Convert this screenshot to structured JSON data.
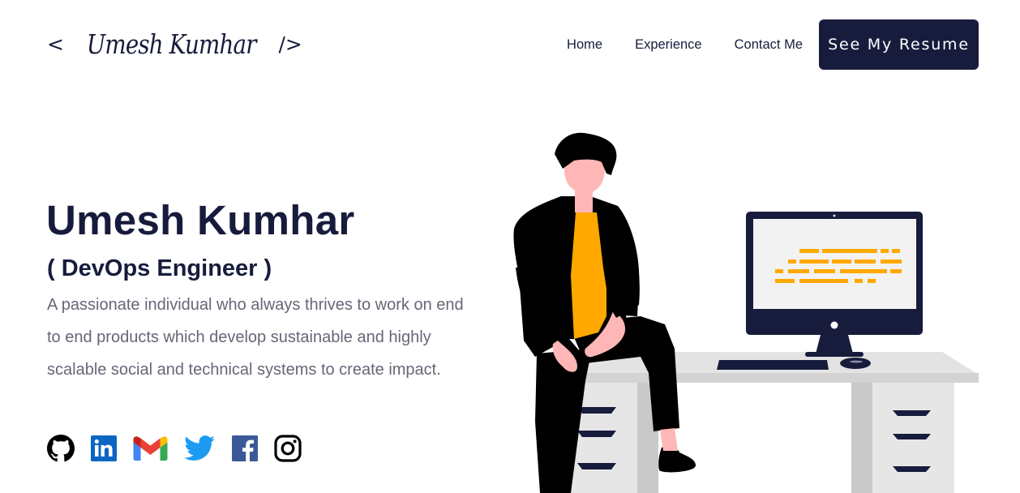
{
  "header": {
    "logo": {
      "open": "<",
      "signature": "Umesh Kumhar",
      "close": "/>"
    },
    "nav": [
      {
        "label": "Home"
      },
      {
        "label": "Experience"
      },
      {
        "label": "Contact Me"
      }
    ],
    "resume_button": "See My Resume"
  },
  "hero": {
    "name": "Umesh Kumhar",
    "role": "( DevOps Engineer )",
    "description": "A passionate individual who always thrives to work on end to end products which develop sustainable and highly scalable social and technical systems to create impact."
  },
  "socials": [
    {
      "icon": "github-icon"
    },
    {
      "icon": "linkedin-icon",
      "color": "#0a66c2"
    },
    {
      "icon": "gmail-icon"
    },
    {
      "icon": "twitter-icon",
      "color": "#1d9bf0"
    },
    {
      "icon": "facebook-icon",
      "color": "#3b5998"
    },
    {
      "icon": "instagram-icon"
    }
  ],
  "colors": {
    "primary": "#171c3d",
    "accent": "#ffa800",
    "text_muted": "#666777"
  }
}
